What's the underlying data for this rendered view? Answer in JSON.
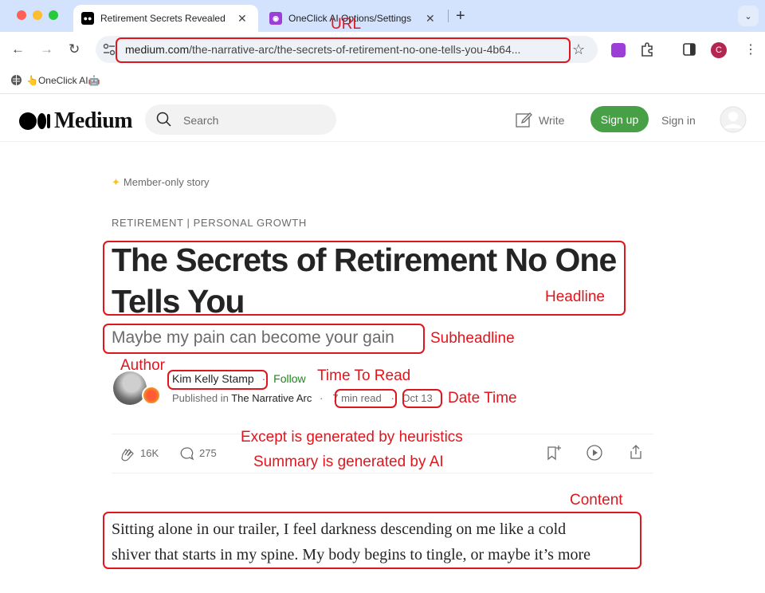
{
  "browser": {
    "tabs": [
      {
        "title": "Retirement Secrets Revealed",
        "active": true
      },
      {
        "title": "OneClick AI Options/Settings",
        "active": false
      }
    ],
    "url_domain": "medium.com",
    "url_path": "/the-narrative-arc/the-secrets-of-retirement-no-one-tells-you-4b64...",
    "bookmark": "👆OneClick AI🤖",
    "profile_initial": "C"
  },
  "medium_header": {
    "logo": "Medium",
    "search_placeholder": "Search",
    "write": "Write",
    "signup": "Sign up",
    "signin": "Sign in"
  },
  "article": {
    "member_badge": "Member-only story",
    "topics": "RETIREMENT | PERSONAL GROWTH",
    "headline_line1": "The Secrets of Retirement No One",
    "headline_line2": "Tells You",
    "subheadline": "Maybe my pain can become your gain",
    "author": "Kim Kelly Stamp",
    "follow": "Follow",
    "published_in_label": "Published in",
    "publication": "The Narrative Arc",
    "read_time": "7 min read",
    "date": "Oct 13",
    "claps": "16K",
    "responses": "275",
    "content_line1": "Sitting alone in our trailer, I feel darkness descending on me like a cold",
    "content_line2": "shiver that starts in my spine. My body begins to tingle, or maybe it’s more"
  },
  "annotations": {
    "url": "URL",
    "headline": "Headline",
    "subheadline": "Subheadline",
    "author": "Author",
    "time_to_read": "Time To Read",
    "date_time": "Date Time",
    "excerpt_note": "Except is generated by heuristics",
    "summary_note": "Summary is generated by AI",
    "content": "Content",
    "color": "#e0161e"
  }
}
